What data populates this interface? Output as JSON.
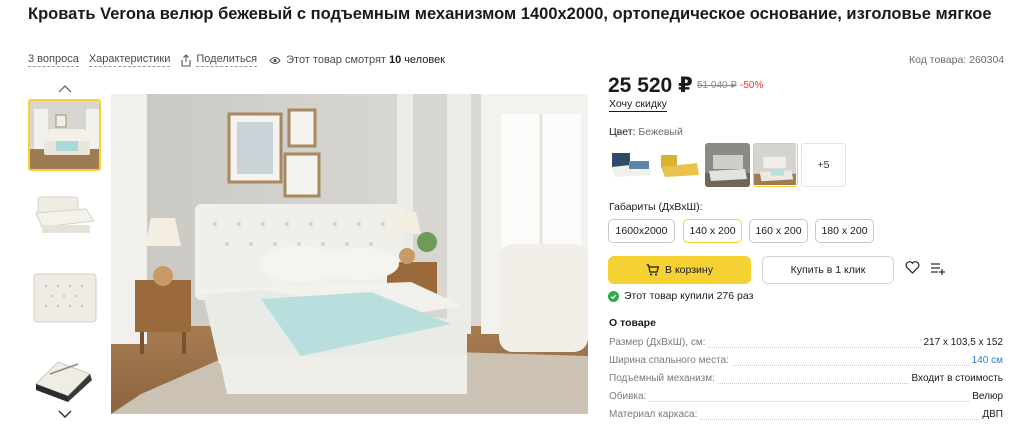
{
  "product": {
    "title": "Кровать Verona велюр бежевый с подъемным механизмом 1400х2000, ортопедическое основание, изголовье мягкое"
  },
  "meta": {
    "questions": "3 вопроса",
    "specs_link": "Характеристики",
    "share": "Поделиться",
    "viewing_prefix": "Этот товар смотрят",
    "viewing_count": "10",
    "viewing_suffix": "человек"
  },
  "code": "Код товара: 260304",
  "price": {
    "current": "25 520 ₽",
    "old": "51 040 ₽",
    "discount": "-50%",
    "want_discount": "Хочу скидку"
  },
  "color": {
    "label": "Цвет:",
    "value": "Бежевый",
    "more": "+5"
  },
  "dimensions": {
    "label": "Габариты (ДхВхШ):",
    "sizes": [
      "1600x2000",
      "140 х 200",
      "160 х 200",
      "180 х 200"
    ]
  },
  "actions": {
    "cart": "В корзину",
    "one_click": "Купить в 1 клик"
  },
  "bought": "Этот товар купили 276 раз",
  "about": {
    "heading": "О товаре",
    "specs": [
      {
        "key": "Размер (ДхВхШ), см:",
        "value": "217 х 103,5 х 152"
      },
      {
        "key": "Ширина спального места:",
        "value": "140 см"
      },
      {
        "key": "Подъемный механизм:",
        "value": "Входит в стоимость"
      },
      {
        "key": "Обивка:",
        "value": "Велюр"
      },
      {
        "key": "Материал каркаса:",
        "value": "ДВП"
      }
    ]
  },
  "colors": {
    "accent": "#f5d132",
    "discount": "#e53935",
    "link": "#2d7fd6",
    "success": "#2fa84f"
  }
}
